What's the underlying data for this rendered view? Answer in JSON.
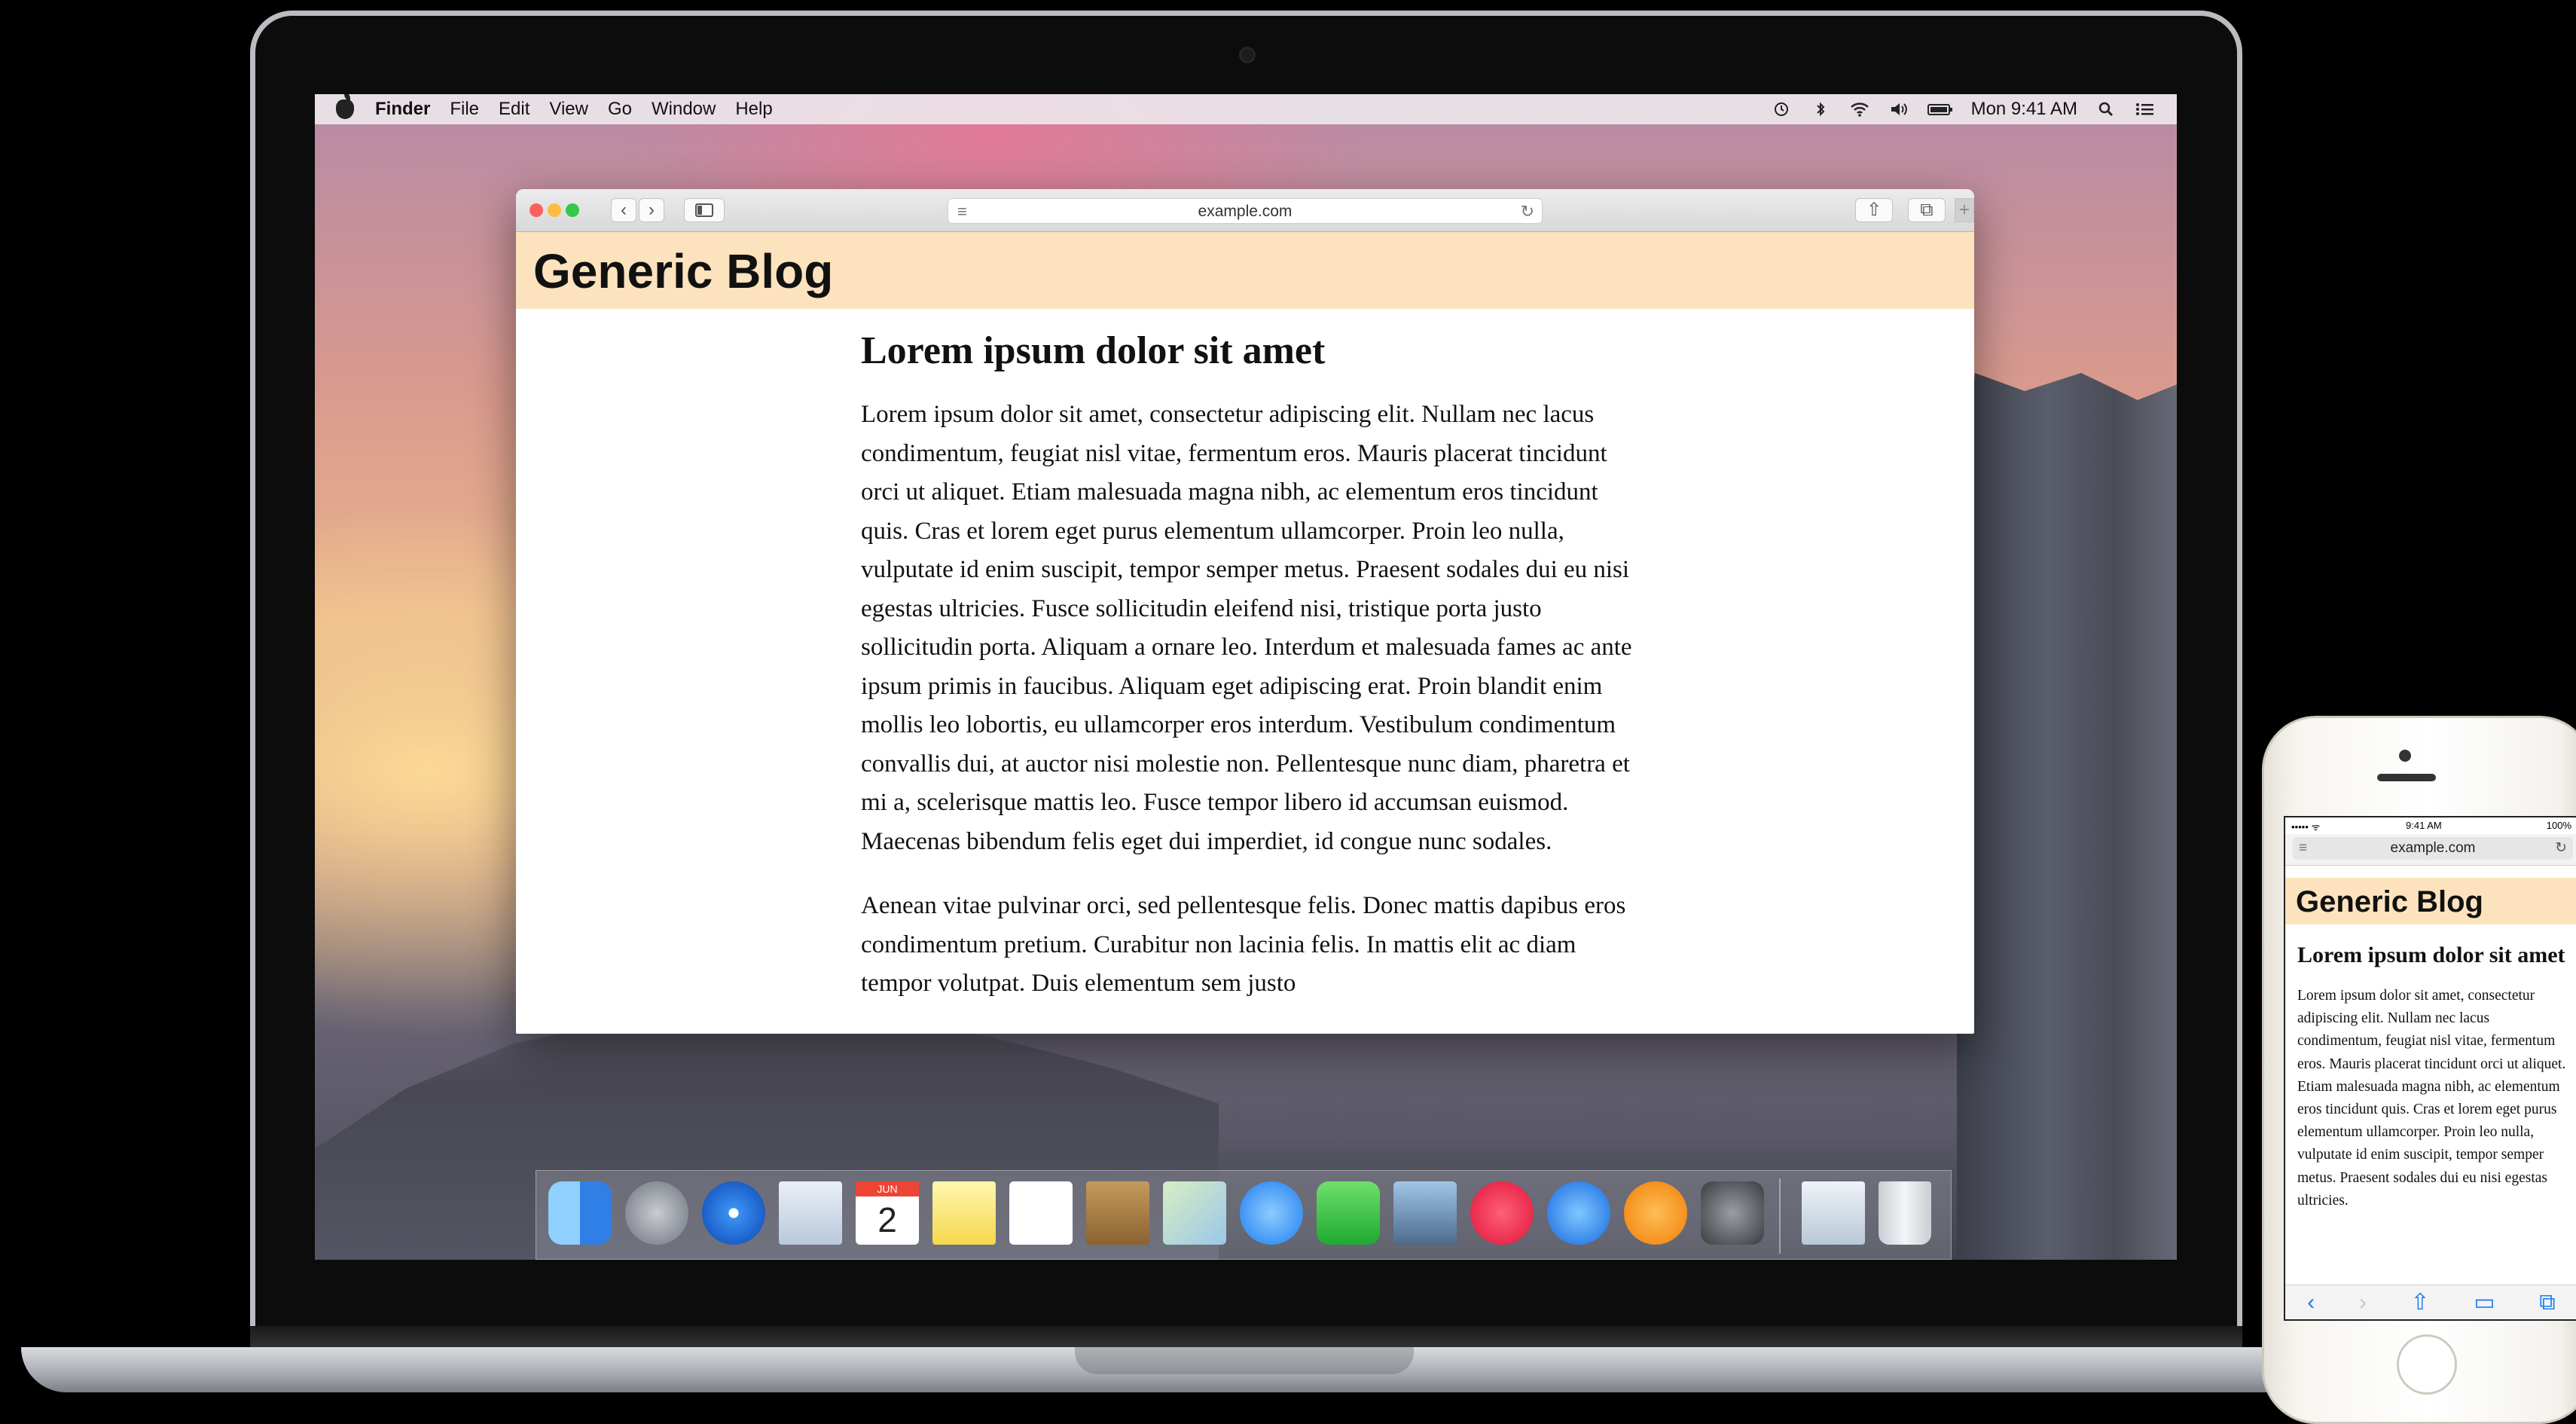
{
  "menubar": {
    "app_name": "Finder",
    "items": [
      "File",
      "Edit",
      "View",
      "Go",
      "Window",
      "Help"
    ],
    "clock": "Mon 9:41 AM",
    "status_icons": [
      "time-machine-icon",
      "bluetooth-icon",
      "wifi-icon",
      "volume-icon",
      "battery-icon",
      "spotlight-icon",
      "notification-center-icon"
    ]
  },
  "safari": {
    "address": "example.com",
    "buttons": {
      "back": "‹",
      "forward": "›",
      "sidebar": "▯",
      "share": "⇧",
      "tabs": "⧉",
      "new_tab": "+"
    }
  },
  "blog": {
    "title": "Generic Blog",
    "article_title": "Lorem ipsum dolor sit amet",
    "paragraphs": [
      "Lorem ipsum dolor sit amet, consectetur adipiscing elit. Nullam nec lacus condimentum, feugiat nisl vitae, fermentum eros. Mauris placerat tincidunt orci ut aliquet. Etiam malesuada magna nibh, ac elementum eros tincidunt quis. Cras et lorem eget purus elementum ullamcorper. Proin leo nulla, vulputate id enim suscipit, tempor semper metus. Praesent sodales dui eu nisi egestas ultricies. Fusce sollicitudin eleifend nisi, tristique porta justo sollicitudin porta. Aliquam a ornare leo. Interdum et malesuada fames ac ante ipsum primis in faucibus. Aliquam eget adipiscing erat. Proin blandit enim mollis leo lobortis, eu ullamcorper eros interdum. Vestibulum condimentum convallis dui, at auctor nisi molestie non. Pellentesque nunc diam, pharetra et mi a, scelerisque mattis leo. Fusce tempor libero id accumsan euismod. Maecenas bibendum felis eget dui imperdiet, id congue nunc sodales.",
      "Aenean vitae pulvinar orci, sed pellentesque felis. Donec mattis dapibus eros condimentum pretium. Curabitur non lacinia felis. In mattis elit ac diam tempor volutpat. Duis elementum sem justo"
    ]
  },
  "dock": {
    "apps": [
      "finder-icon",
      "launchpad-icon",
      "safari-icon",
      "mail-icon",
      "calendar-icon",
      "notes-icon",
      "reminders-icon",
      "contacts-icon",
      "maps-icon",
      "messages-icon",
      "facetime-icon",
      "photo-booth-icon",
      "itunes-icon",
      "app-store-icon",
      "ibooks-icon",
      "system-preferences-icon",
      "preview-icon",
      "trash-icon"
    ],
    "calendar_month": "JUN",
    "calendar_day": "2"
  },
  "iphone": {
    "time": "9:41 AM",
    "signal": "••••• ᯤ",
    "battery": "100%",
    "address": "example.com",
    "blog_title": "Generic Blog",
    "article_title": "Lorem ipsum dolor sit amet",
    "paragraph": "Lorem ipsum dolor sit amet, consectetur adipiscing elit. Nullam nec lacus condimentum, feugiat nisl vitae, fermentum eros. Mauris placerat tincidunt orci ut aliquet. Etiam malesuada magna nibh, ac elementum eros tincidunt quis. Cras et lorem eget purus elementum ullamcorper. Proin leo nulla, vulputate id enim suscipit, tempor semper metus. Praesent sodales dui eu nisi egestas ultricies.",
    "tabbar": [
      "‹",
      "›",
      "⇧",
      "▭",
      "⧉"
    ]
  },
  "colors": {
    "blog_header": "#fde3bd",
    "traffic_red": "#fc605c",
    "traffic_yellow": "#fdbc40",
    "traffic_green": "#34c84a",
    "ios_blue": "#1a7cf3"
  }
}
